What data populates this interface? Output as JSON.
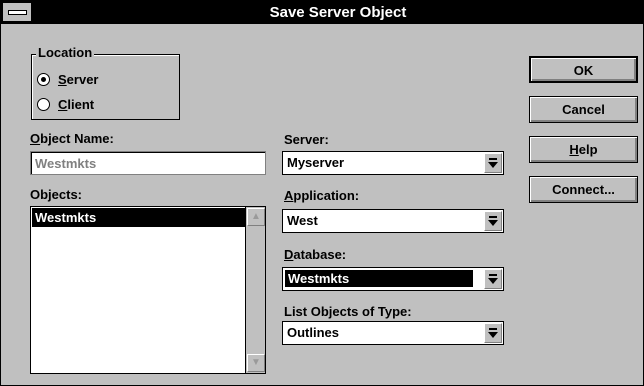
{
  "window": {
    "title": "Save Server Object"
  },
  "location": {
    "label": "Location",
    "options": [
      {
        "label": "Server",
        "checked": true
      },
      {
        "label": "Client",
        "checked": false
      }
    ]
  },
  "object_name": {
    "label": "Object Name:",
    "value": "Westmkts"
  },
  "objects": {
    "label": "Objects:",
    "items": [
      "Westmkts"
    ],
    "selected": "Westmkts"
  },
  "server": {
    "label": "Server:",
    "value": "Myserver"
  },
  "application": {
    "label": "Application:",
    "value": "West"
  },
  "database": {
    "label": "Database:",
    "value": "Westmkts"
  },
  "object_type": {
    "label": "List Objects of Type:",
    "value": "Outlines"
  },
  "buttons": {
    "ok": "OK",
    "cancel": "Cancel",
    "help": "Help",
    "connect": "Connect..."
  },
  "icons": [
    "system-menu-icon",
    "radio-selected-icon",
    "radio-unselected-icon",
    "scroll-up-arrow-icon",
    "scroll-down-arrow-icon",
    "dropdown-arrow-icon"
  ]
}
